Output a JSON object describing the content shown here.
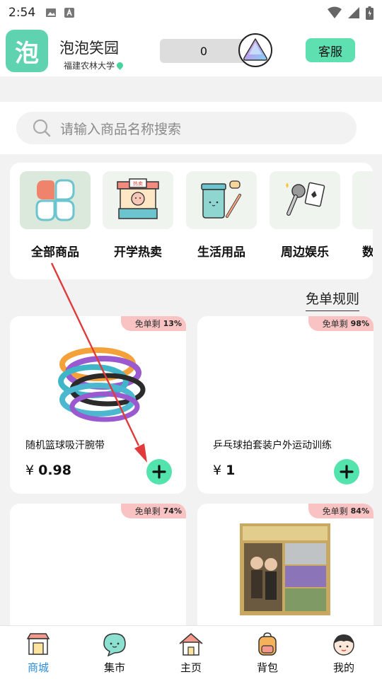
{
  "status_bar": {
    "time": "2:54"
  },
  "header": {
    "app_name": "泡泡笑园",
    "logo_char": "泡",
    "school": "福建农林大学",
    "coin_balance": "0",
    "service_label": "客服"
  },
  "search": {
    "placeholder": "请输入商品名称搜索"
  },
  "categories": [
    {
      "label": "全部商品",
      "icon": "clover-icon"
    },
    {
      "label": "开学热卖",
      "icon": "hot-sale-stall-icon"
    },
    {
      "label": "生活用品",
      "icon": "towel-toothbrush-icon"
    },
    {
      "label": "周边娱乐",
      "icon": "microphone-cards-icon"
    },
    {
      "label": "数",
      "icon": "digital-icon"
    }
  ],
  "rules_label": "免单规则",
  "products": [
    {
      "name": "随机篮球吸汗腕带",
      "price_symbol": "¥",
      "price": "0.98",
      "badge_label": "免单剩",
      "badge_pct": "13%"
    },
    {
      "name": "乒乓球拍套装户外运动训练",
      "price_symbol": "¥",
      "price": "1",
      "badge_label": "免单剩",
      "badge_pct": "98%"
    },
    {
      "name": "",
      "price_symbol": "",
      "price": "",
      "badge_label": "免单剩",
      "badge_pct": "74%"
    },
    {
      "name": "",
      "price_symbol": "",
      "price": "",
      "badge_label": "免单剩",
      "badge_pct": "84%"
    }
  ],
  "tabs": [
    {
      "label": "商城",
      "icon": "shop-icon",
      "active": true
    },
    {
      "label": "集市",
      "icon": "chat-bubble-icon",
      "active": false
    },
    {
      "label": "主页",
      "icon": "home-icon",
      "active": false
    },
    {
      "label": "背包",
      "icon": "backpack-icon",
      "active": false
    },
    {
      "label": "我的",
      "icon": "avatar-icon",
      "active": false
    }
  ],
  "colors": {
    "accent": "#53e3ad",
    "logo": "#5fd3b0",
    "badge": "#f9c3c3",
    "active_tab": "#2a8cd8",
    "annotation_arrow": "#e03a3a"
  }
}
